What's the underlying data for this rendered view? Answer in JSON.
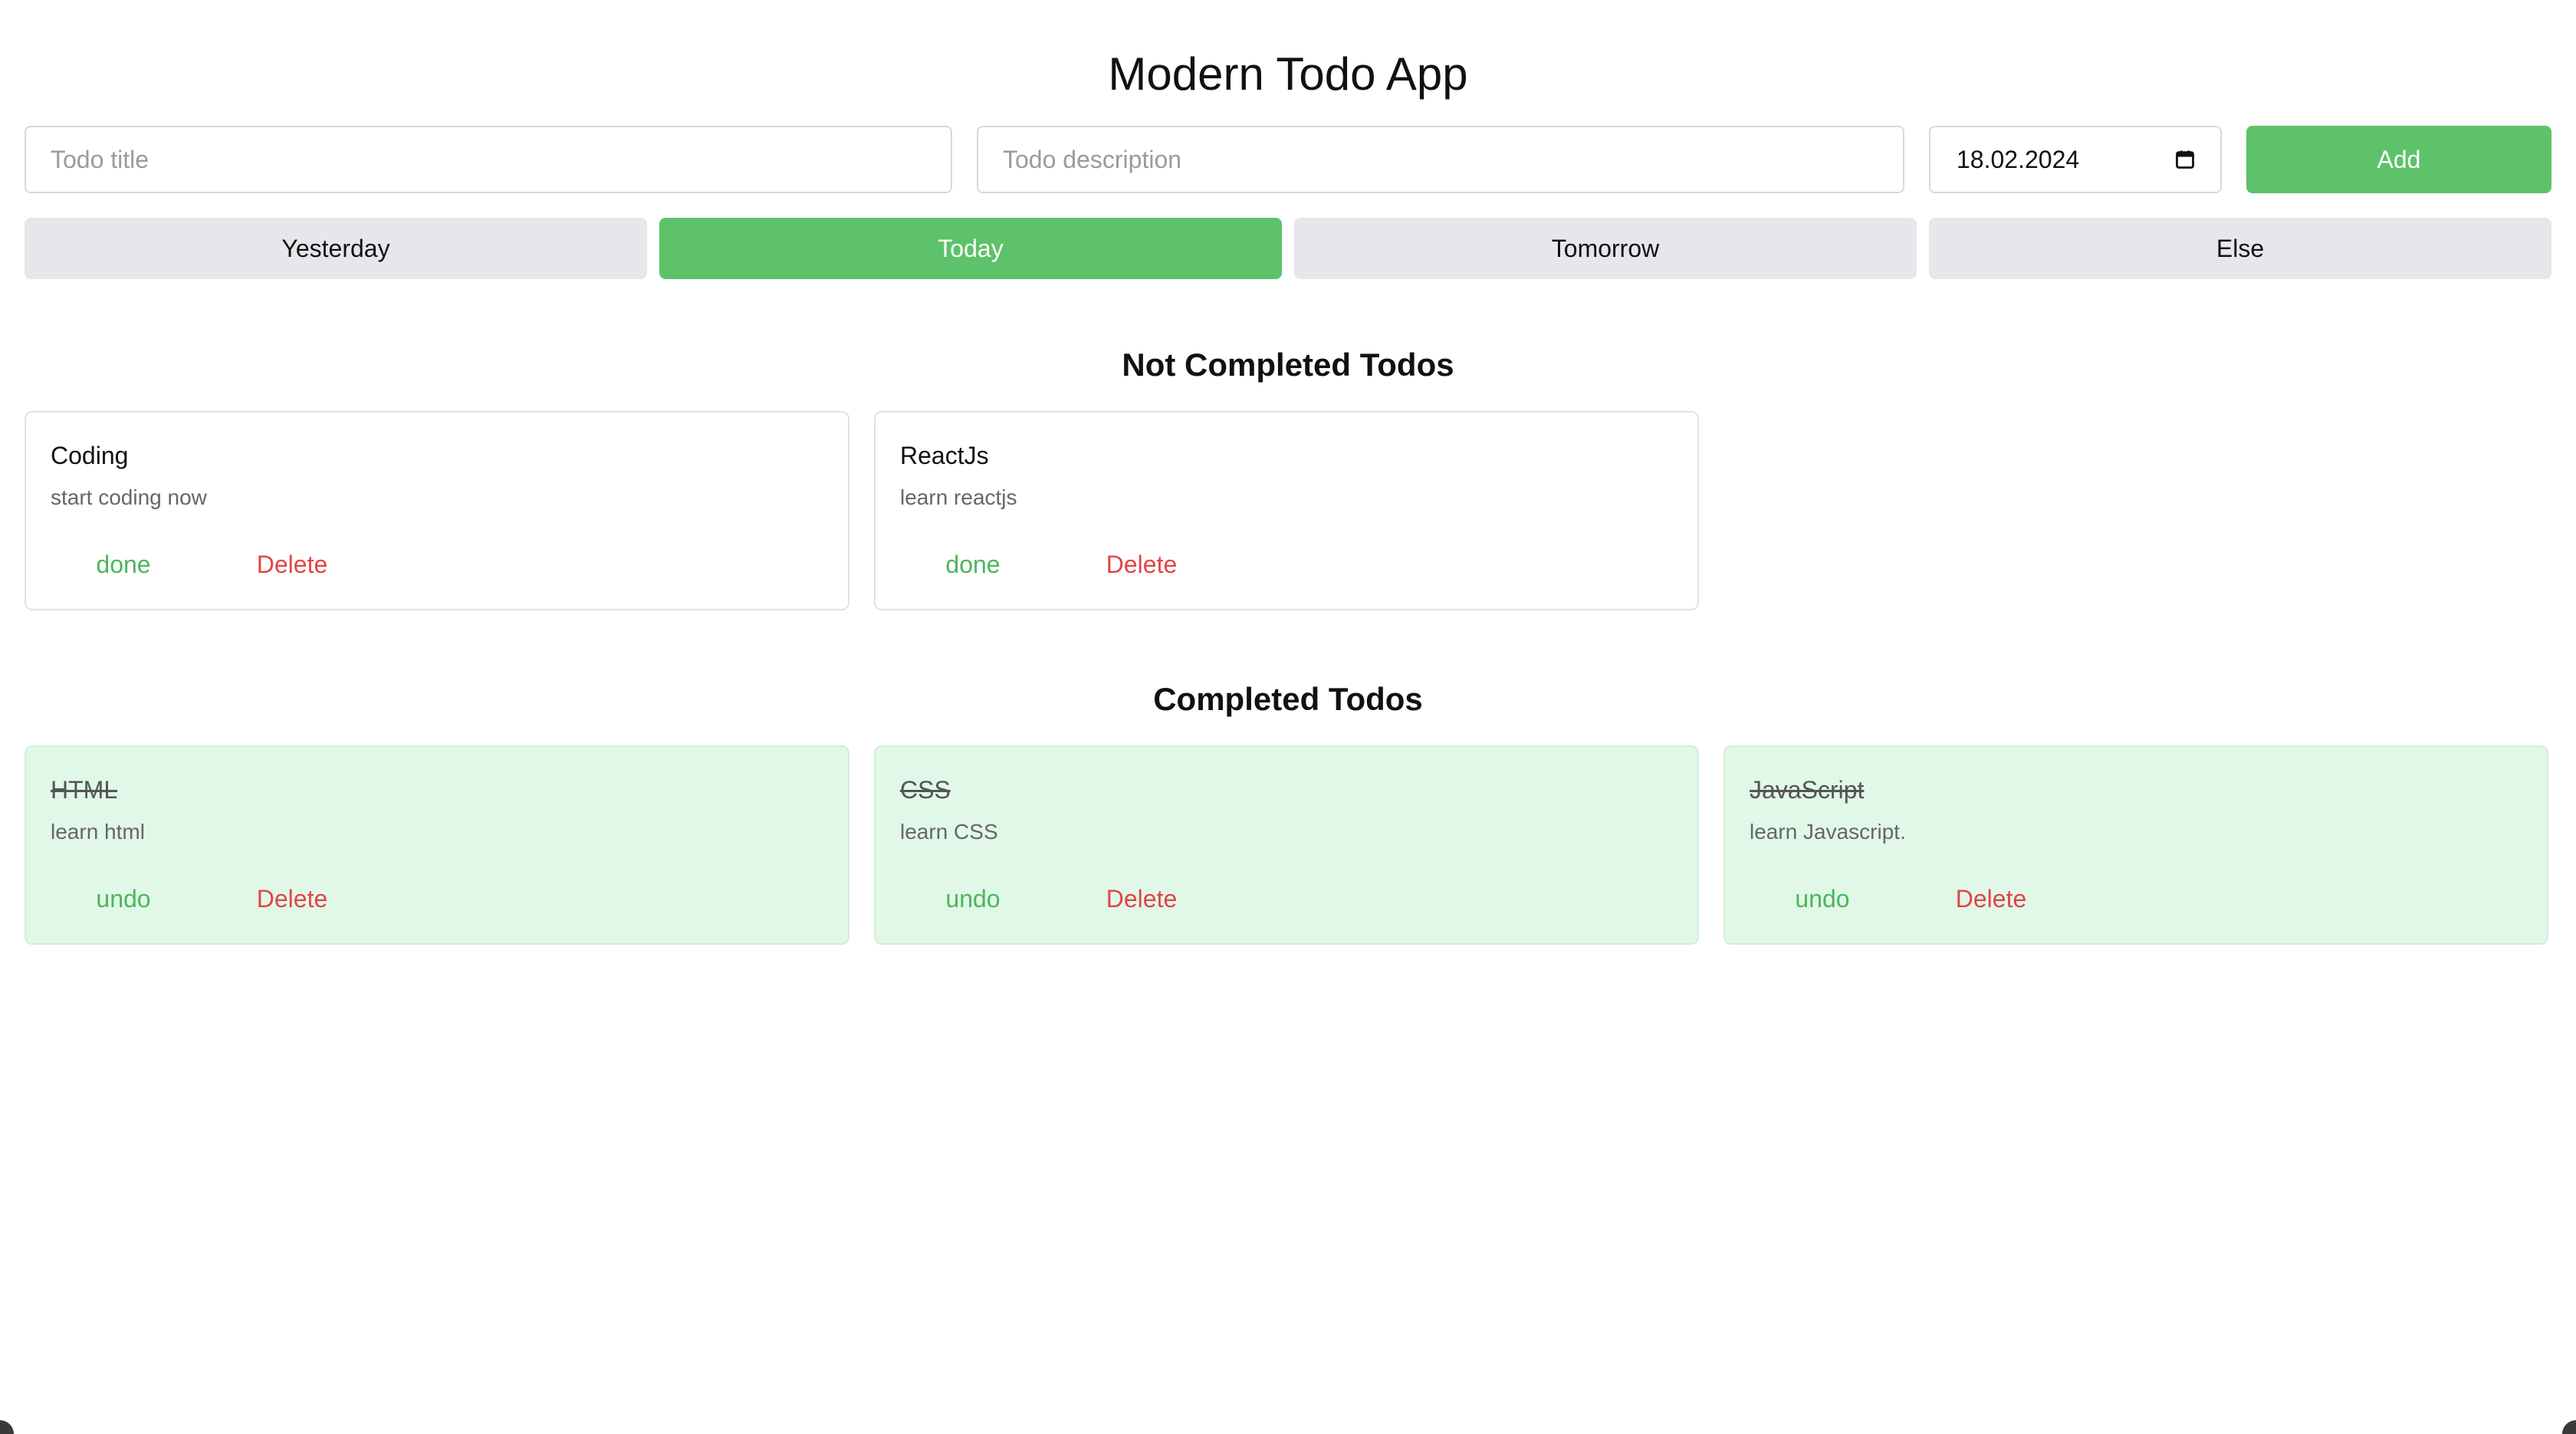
{
  "app": {
    "title": "Modern Todo App"
  },
  "form": {
    "title_placeholder": "Todo title",
    "description_placeholder": "Todo description",
    "date_value": "18.02.2024",
    "date_icon": "calendar-icon",
    "add_label": "Add"
  },
  "filters": [
    {
      "label": "Yesterday",
      "active": false
    },
    {
      "label": "Today",
      "active": true
    },
    {
      "label": "Tomorrow",
      "active": false
    },
    {
      "label": "Else",
      "active": false
    }
  ],
  "not_completed": {
    "heading": "Not Completed Todos",
    "items": [
      {
        "title": "Coding",
        "description": "start coding now",
        "primary_action": "done",
        "delete_action": "Delete"
      },
      {
        "title": "ReactJs",
        "description": "learn reactjs",
        "primary_action": "done",
        "delete_action": "Delete"
      }
    ]
  },
  "completed": {
    "heading": "Completed Todos",
    "items": [
      {
        "title": "HTML",
        "description": "learn html",
        "primary_action": "undo",
        "delete_action": "Delete"
      },
      {
        "title": "CSS",
        "description": "learn CSS",
        "primary_action": "undo",
        "delete_action": "Delete"
      },
      {
        "title": "JavaScript",
        "description": "learn Javascript.",
        "primary_action": "undo",
        "delete_action": "Delete"
      }
    ]
  },
  "colors": {
    "accent": "#5ec26a",
    "done_text": "#4cb55c",
    "delete_text": "#e04545",
    "completed_card_bg": "#e1f8e8",
    "filter_bg": "#e5e7ea"
  }
}
